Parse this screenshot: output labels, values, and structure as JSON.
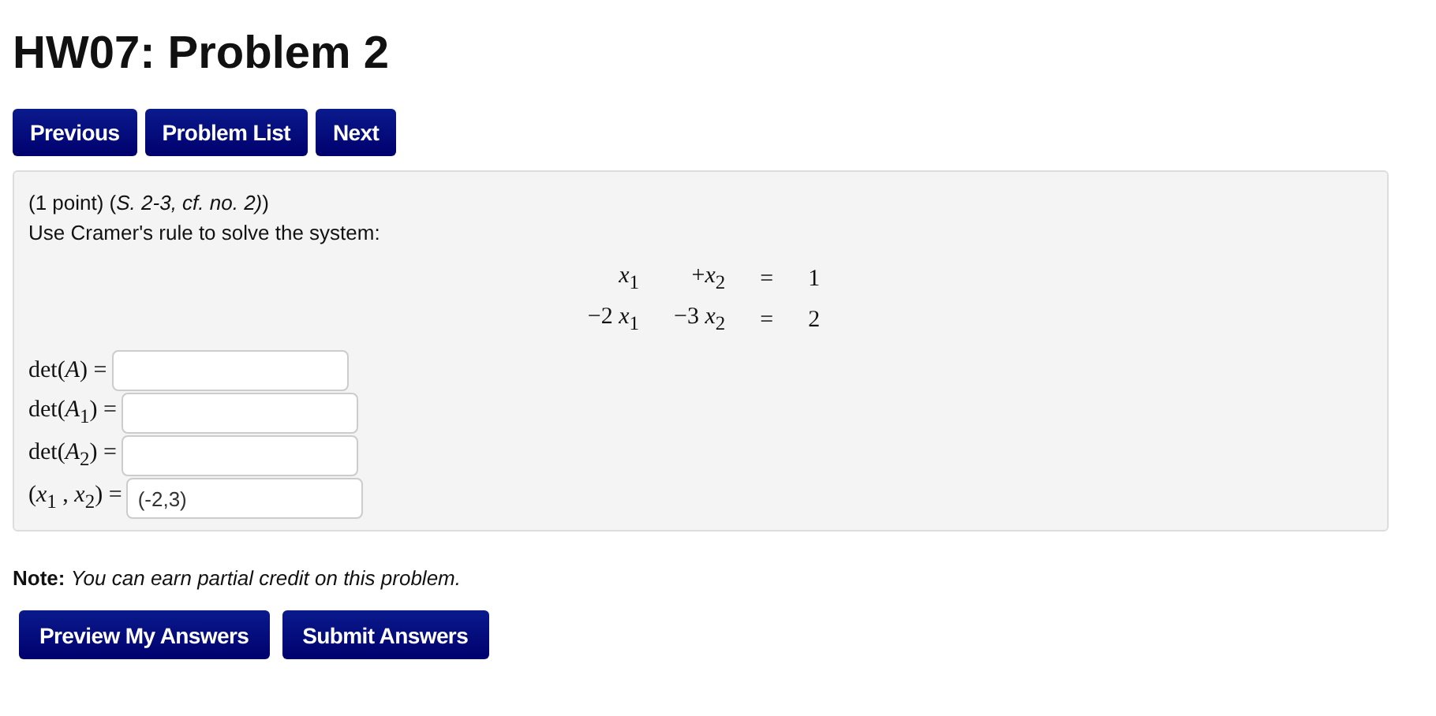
{
  "title": "HW07: Problem 2",
  "nav_buttons": [
    "Previous",
    "Problem List",
    "Next"
  ],
  "problem": {
    "header": "(1 point) (*S. 2-3, cf. no. 2)*)",
    "instruction": "Use Cramer's rule to solve the system:",
    "equations": [
      [
        "*x*$_{1}$",
        "+*x*$_{2}$",
        "=",
        "1"
      ],
      [
        "−2 *x*$_{1}$",
        "−3 *x*$_{2}$",
        "=",
        "2"
      ]
    ],
    "answers": [
      {
        "label": "det(*A*) ="
      },
      {
        "label": "det(*A*$_{1}$) ="
      },
      {
        "label": "det(*A*$_{2}$) ="
      },
      {
        "label": "(*x*$_{1}$ , *x*$_{2}$) =",
        "value": "(-2,3)"
      }
    ]
  },
  "note": "**Note:** *You can earn partial credit on this problem.*",
  "submit_buttons": [
    "Preview My Answers",
    "Submit Answers"
  ]
}
